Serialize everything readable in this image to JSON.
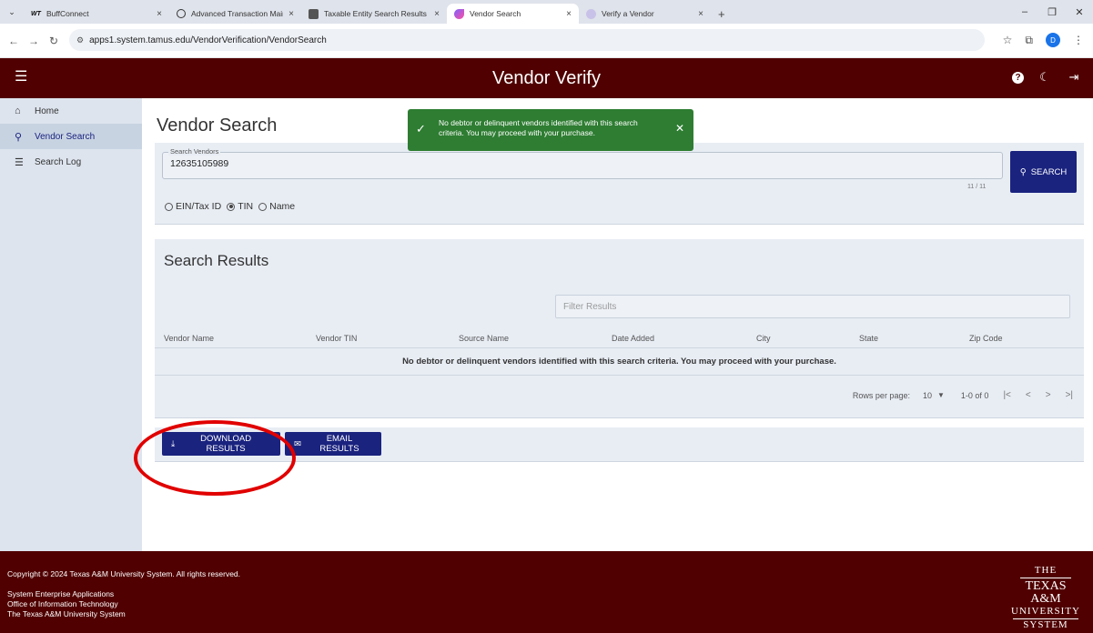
{
  "browser": {
    "tabs": [
      {
        "label": "BuffConnect",
        "favicon": "WT",
        "active": false
      },
      {
        "label": "Advanced Transaction Mainten",
        "favicon": "globe",
        "active": false
      },
      {
        "label": "Taxable Entity Search Results",
        "favicon": "image",
        "active": false
      },
      {
        "label": "Vendor Search",
        "favicon": "vendor",
        "active": true
      },
      {
        "label": "Verify a Vendor",
        "favicon": "globe",
        "active": false
      }
    ],
    "url": "apps1.system.tamus.edu/VendorVerification/VendorSearch",
    "profile_initial": "D"
  },
  "app": {
    "title": "Vendor Verify",
    "brand_color": "#500000",
    "accent_color": "#1a237e"
  },
  "sidebar": {
    "items": [
      {
        "label": "Home",
        "icon": "home-icon",
        "active": false
      },
      {
        "label": "Vendor Search",
        "icon": "search-icon",
        "active": true
      },
      {
        "label": "Search Log",
        "icon": "list-icon",
        "active": false
      }
    ]
  },
  "search": {
    "page_title": "Vendor Search",
    "field_label": "Search Vendors",
    "value": "12635105989",
    "counter": "11 / 11",
    "button_label": "SEARCH",
    "options": [
      {
        "label": "EIN/Tax ID",
        "selected": false
      },
      {
        "label": "TIN",
        "selected": true
      },
      {
        "label": "Name",
        "selected": false
      }
    ]
  },
  "results": {
    "title": "Search Results",
    "filter_placeholder": "Filter Results",
    "columns": [
      "Vendor Name",
      "Vendor TIN",
      "Source Name",
      "Date Added",
      "City",
      "State",
      "Zip Code"
    ],
    "empty_message": "No debtor or delinquent vendors identified with this search criteria. You may proceed with your purchase.",
    "rows_per_page_label": "Rows per page:",
    "rows_per_page": "10",
    "range": "1-0 of 0"
  },
  "actions": {
    "download_label": "DOWNLOAD RESULTS",
    "email_label": "EMAIL RESULTS"
  },
  "toast": {
    "message": "No debtor or delinquent vendors identified with this search criteria. You may proceed with your purchase.",
    "color": "#2e7d32"
  },
  "footer": {
    "copyright": "Copyright © 2024 Texas A&M University System. All rights reserved.",
    "line1": "System Enterprise Applications",
    "line2": "Office of Information Technology",
    "line3": "The Texas A&M University System",
    "logo": {
      "l1": "THE",
      "l2": "TEXAS A&M",
      "l3": "UNIVERSITY",
      "l4": "SYSTEM"
    }
  },
  "annotation": {
    "color": "#e10000"
  }
}
